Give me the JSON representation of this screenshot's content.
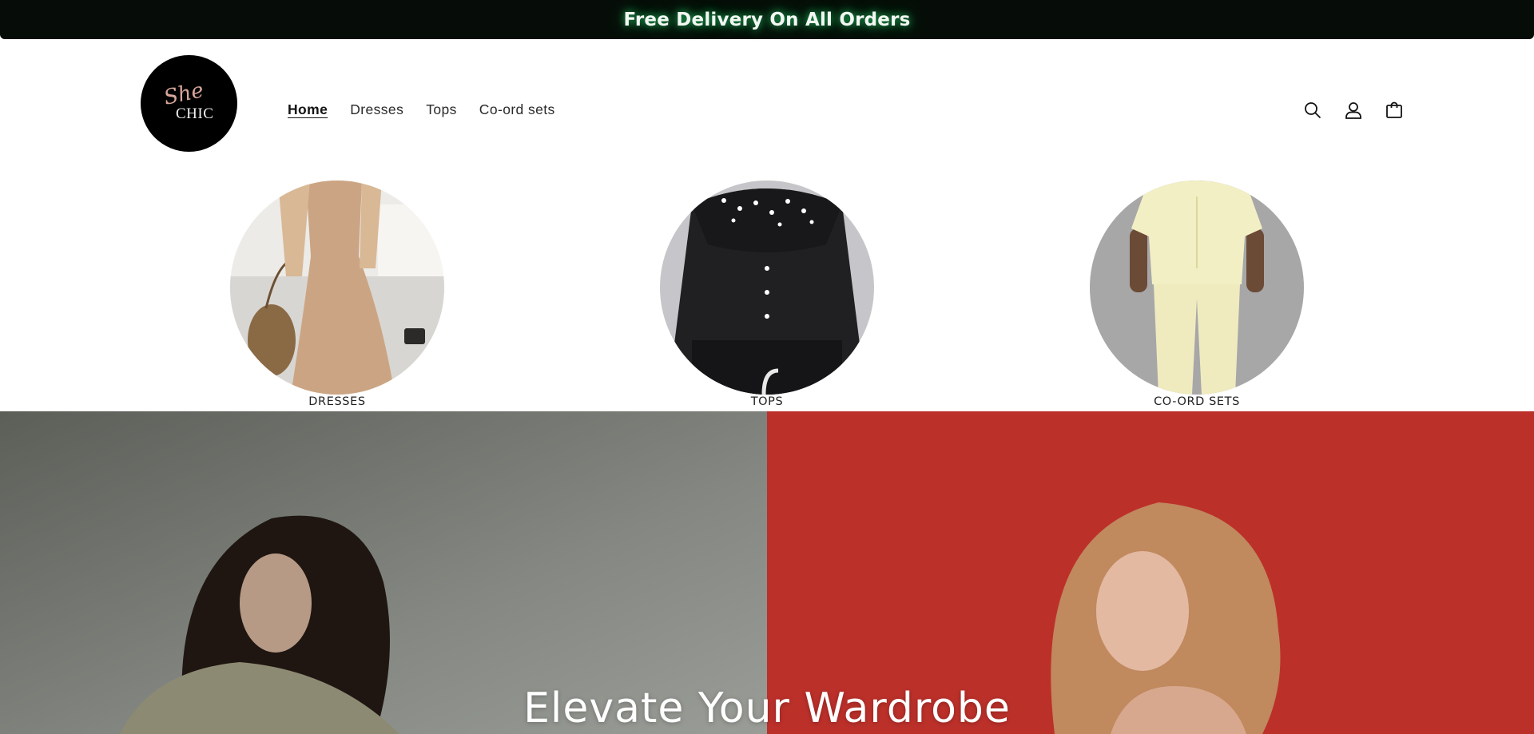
{
  "announcement": {
    "text": "Free Delivery On All Orders"
  },
  "header": {
    "logo": {
      "line1": "She",
      "line2": "CHIC"
    },
    "nav": [
      {
        "label": "Home",
        "active": true
      },
      {
        "label": "Dresses",
        "active": false
      },
      {
        "label": "Tops",
        "active": false
      },
      {
        "label": "Co-ord sets",
        "active": false
      }
    ],
    "icons": [
      "search-icon",
      "account-icon",
      "cart-icon"
    ]
  },
  "categories": [
    {
      "label": "DRESSES"
    },
    {
      "label": "TOPS"
    },
    {
      "label": "CO-ORD SETS"
    }
  ],
  "hero": {
    "title": "Elevate Your Wardrobe"
  },
  "colors": {
    "announcement_bg": "#060d08",
    "glow": "#28dc6e",
    "hero_red": "#c0302a",
    "hero_gray": "#7a7d77"
  }
}
